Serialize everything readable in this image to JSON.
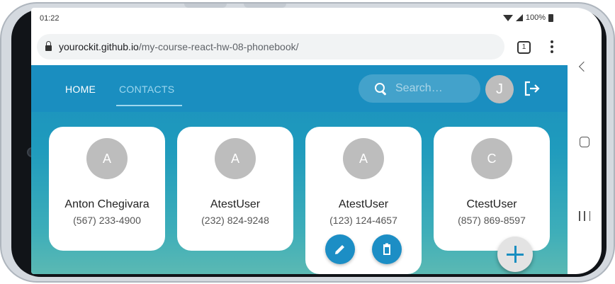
{
  "status_bar": {
    "time": "01:22",
    "battery": "100%"
  },
  "browser": {
    "url_host": "yourockit.github.io",
    "url_path": " /my-course-react-hw-08-phonebook/",
    "tab_count": "1"
  },
  "nav": {
    "home": "HOME",
    "contacts": "CONTACTS"
  },
  "search": {
    "placeholder": "Search…"
  },
  "user": {
    "initial": "J"
  },
  "contacts": [
    {
      "initial": "A",
      "name": "Anton Chegivara",
      "phone": "(567) 233-4900"
    },
    {
      "initial": "A",
      "name": "AtestUser",
      "phone": "(232) 824-9248"
    },
    {
      "initial": "A",
      "name": "AtestUser",
      "phone": "(123) 124-4657"
    },
    {
      "initial": "C",
      "name": "CtestUser",
      "phone": "(857) 869-8597"
    }
  ],
  "colors": {
    "accent": "#1a8ec0",
    "card": "#ffffff",
    "avatar": "#bdbdbd"
  },
  "icons": [
    "search-icon",
    "logout-icon",
    "edit-icon",
    "delete-icon",
    "plus-icon",
    "lock-icon"
  ]
}
